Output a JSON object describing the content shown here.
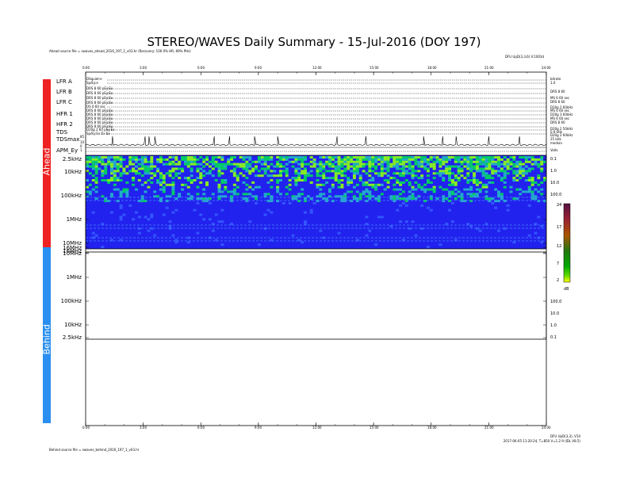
{
  "title": "STEREO/WAVES Daily Summary - 15-Jul-2016 (DOY 197)",
  "ahead_source": "Ahead source file = swaves_ahead_2016_197_1_v03.hr (Recovery: 100.0% HR, 89% PHs)",
  "behind_source": "Behind source file = swaves_behind_2016_197_1_v03.hr",
  "top_right_note": "DFU UpD(3,3,6) V:1003d",
  "bottom_right_note_1": "DFU UpD(3,3), V10",
  "bottom_right_note_2": "2017-06-05 11:20:24, T=850 V=1.2.9 (IDL V8.5)",
  "panels": {
    "ahead": "Ahead",
    "behind": "Behind"
  },
  "time_axis": {
    "ticks": [
      "0:00",
      "3:00",
      "6:00",
      "9:00",
      "12:00",
      "15:00",
      "18:00",
      "21:00",
      "24:00"
    ]
  },
  "left_labels": {
    "lfr_a": "LFR A",
    "lfr_b": "LFR B",
    "lfr_c": "LFR C",
    "hfr_1": "HFR 1",
    "hfr_2": "HFR 2",
    "tds": "TDS",
    "tdsmax": "TDSmax",
    "tdsmax_val": "85",
    "tdsmax_low_a": "10",
    "tdsmax_low_b": "0",
    "apm": "APM_Ey",
    "apm_val": "1"
  },
  "freq_labels_ahead": [
    "2.5kHz",
    "10kHz",
    "100kHz",
    "1MHz",
    "10MHz",
    "16MHz"
  ],
  "freq_labels_behind": [
    "16MHz",
    "10MHz",
    "1MHz",
    "100kHz",
    "10kHz",
    "2.5kHz"
  ],
  "right_scale_ahead": [
    "0.1",
    "1.0",
    "10.0",
    "100.0"
  ],
  "right_scale_behind": [
    "100.0",
    "10.0",
    "1.0",
    "0.1"
  ],
  "right_hk_labels": {
    "lfr_a_1": "bitrate",
    "lfr_a_2": "1.0",
    "lfr_b": "DRS 8 60",
    "lfr_c_1": "MS 6 60 sec",
    "lfr_c_2": "DRS 8 60",
    "hfr_1a": "D20g 2 60kHz",
    "hfr_1b": "MS 6 60 sec",
    "hfr_1c": "D20g 3 60kHz",
    "hfr_1d": "MS 6 60 sec",
    "hfr_1e": "DRS 8 60",
    "tds_1": "D20g 2 50kHz",
    "tds_2": "0.9 kHz",
    "tds_3": "D20g 2 60kHz",
    "tdsmax_r1": "25 kHz",
    "tdsmax_r2": "median",
    "apm_r": "Volts"
  },
  "hk_row_labels": [
    "DSquiet:e",
    "Sp/Ey:e",
    "DRS 8 60 pEy:Ex",
    "DRS 8 60 pEy:Ex",
    "DRS 8 60 pEy:Ex",
    "DRS 8 60 pEy:Ex",
    "OS 6 60 sec",
    "DRS 8 60 pEy:Ex",
    "DRS 8 60 pEy:Ex",
    "DRS 8 60 pEy:Ex",
    "DRS 8 60 pEy:Ex",
    "DRS 8 60 pEy:Ex",
    "D20g 2 60 pEy:Ex",
    "Sp/Ey:Ex:Ex:Ex"
  ],
  "colorbar": {
    "ticks": [
      "24",
      "17",
      "12",
      "7",
      "2"
    ],
    "unit": "dB",
    "range": [
      2,
      24
    ]
  },
  "chart_data": {
    "type": "heatmap",
    "title": "STEREO/WAVES Daily Summary - 15-Jul-2016 (DOY 197)",
    "x_range_hours": [
      0,
      24
    ],
    "x_ticks": [
      "0:00",
      "3:00",
      "6:00",
      "9:00",
      "12:00",
      "15:00",
      "18:00",
      "21:00",
      "24:00"
    ],
    "y_scale": "log",
    "y_range": [
      "2.5kHz",
      "16MHz"
    ],
    "z_unit": "dB",
    "z_range": [
      2,
      24
    ],
    "ahead_bands": [
      {
        "freq": "2.5kHz-10kHz",
        "level": "high",
        "time_variation": "intermittent"
      },
      {
        "freq": "10kHz-60kHz",
        "level": "high",
        "time_variation": "strongest 13:00-22:00"
      },
      {
        "freq": "60kHz-100kHz",
        "level": "mid",
        "time_variation": "patchy"
      },
      {
        "freq": "100kHz-16MHz",
        "level": "background",
        "time_variation": "steady"
      }
    ],
    "behind_data": "none",
    "tdsmax_peaks_hours": [
      1.4,
      3.1,
      3.3,
      3.6,
      6.7,
      7.5,
      8.8,
      10.0,
      13.1,
      14.6,
      17.6,
      18.6,
      19.3,
      21.0,
      22.6
    ]
  }
}
